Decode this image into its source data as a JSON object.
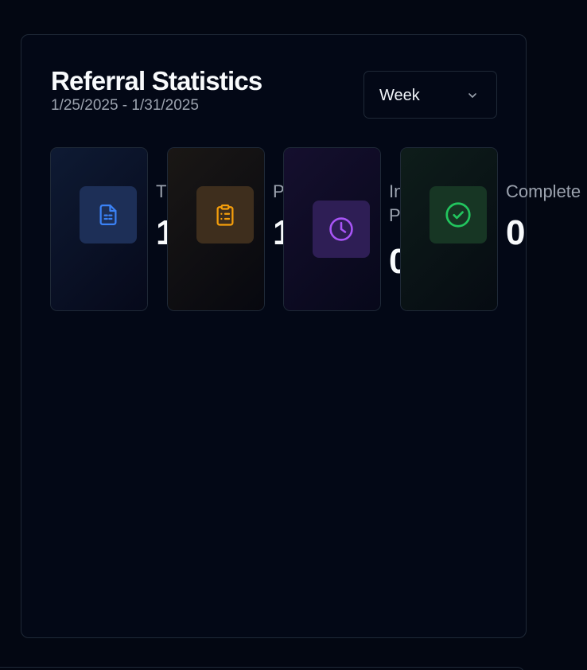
{
  "header": {
    "title": "Referral Statistics",
    "date_range": "1/25/2025 - 1/31/2025"
  },
  "period_select": {
    "value": "Week",
    "icon": "chevron-down-icon"
  },
  "stats": [
    {
      "key": "total",
      "label": "T",
      "value": "1",
      "icon": "document-icon",
      "color": "#3b82f6"
    },
    {
      "key": "pending",
      "label": "P",
      "value": "1",
      "icon": "clipboard-list-icon",
      "color": "#f59e0b"
    },
    {
      "key": "in_progress",
      "label": "In P",
      "value": "0",
      "icon": "clock-icon",
      "color": "#a855f7"
    },
    {
      "key": "completed",
      "label": "Complete",
      "value": "0",
      "icon": "check-circle-icon",
      "color": "#22c55e"
    }
  ]
}
